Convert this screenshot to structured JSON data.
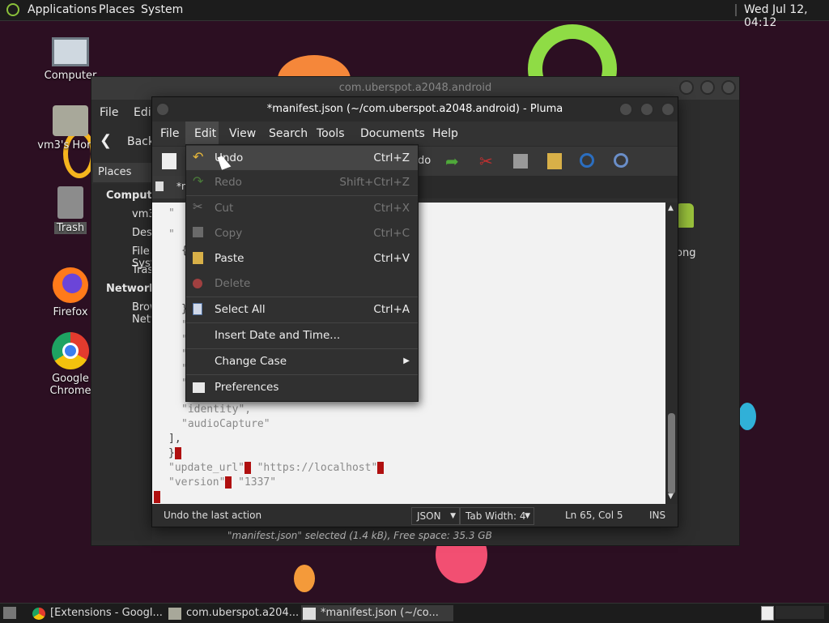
{
  "top_panel": {
    "menus": [
      "Applications",
      "Places",
      "System"
    ],
    "clock": "Wed Jul 12, 04:12"
  },
  "desktop_icons": [
    {
      "label": "Computer",
      "icon": "computer-icon"
    },
    {
      "label": "vm3's Home",
      "icon": "home-folder-icon"
    },
    {
      "label": "Trash",
      "icon": "trash-icon"
    },
    {
      "label": "Firefox",
      "icon": "firefox-icon"
    },
    {
      "label": "Google Chrome",
      "icon": "chrome-icon"
    }
  ],
  "file_manager": {
    "title": "com.uberspot.a2048.android",
    "menus": [
      "File",
      "Edit"
    ],
    "back_label": "Back",
    "places_label": "Places",
    "sidebar": {
      "computer_header": "Computer",
      "computer_items": [
        "vm3",
        "Desktop",
        "File System",
        "Trash"
      ],
      "network_header": "Network",
      "network_items": [
        "Browse Network"
      ]
    },
    "right_icon_label": "ong",
    "status": "\"manifest.json\" selected (1.4 kB), Free space: 35.3 GB"
  },
  "pluma": {
    "title": "*manifest.json (~/com.uberspot.a2048.android) - Pluma",
    "menus": [
      "File",
      "Edit",
      "View",
      "Search",
      "Tools",
      "Documents",
      "Help"
    ],
    "toolbar_partial_label": "do",
    "tab_label": "*n",
    "code_lines": [
      {
        "text": "\"identity\",",
        "indent": 2
      },
      {
        "text": "\"audioCapture\"",
        "indent": 2
      },
      {
        "text": "],",
        "indent": 1
      },
      {
        "text": "}",
        "indent": 1
      },
      {
        "text": "\"update_url\": \"https://localhost\",",
        "indent": 0
      },
      {
        "text": "\"version\": \"1337\"",
        "indent": 0
      }
    ],
    "status_message": "Undo the last action",
    "language": "JSON",
    "tab_width": "Tab Width:  4",
    "position": "Ln 65, Col 5",
    "mode": "INS"
  },
  "edit_menu": {
    "items": [
      {
        "label": "Undo",
        "accel": "Ctrl+Z",
        "icon": "undo-icon",
        "enabled": true,
        "hover": true
      },
      {
        "label": "Redo",
        "accel": "Shift+Ctrl+Z",
        "icon": "redo-icon",
        "enabled": false
      },
      {
        "label": "Cut",
        "accel": "Ctrl+X",
        "icon": "cut-icon",
        "enabled": false
      },
      {
        "label": "Copy",
        "accel": "Ctrl+C",
        "icon": "copy-icon",
        "enabled": false
      },
      {
        "label": "Paste",
        "accel": "Ctrl+V",
        "icon": "paste-icon",
        "enabled": true
      },
      {
        "label": "Delete",
        "accel": "",
        "icon": "delete-icon",
        "enabled": false
      },
      {
        "label": "Select All",
        "accel": "Ctrl+A",
        "icon": "select-all-icon",
        "enabled": true
      },
      {
        "label": "Insert Date and Time...",
        "accel": "",
        "icon": "",
        "enabled": true
      },
      {
        "label": "Change Case",
        "accel": "",
        "icon": "",
        "enabled": true,
        "submenu": true
      },
      {
        "label": "Preferences",
        "accel": "",
        "icon": "preferences-icon",
        "enabled": true
      }
    ]
  },
  "taskbar": {
    "tasks": [
      {
        "label": "[Extensions - Googl...",
        "icon": "chrome-icon"
      },
      {
        "label": "com.uberspot.a204...",
        "icon": "folder-icon"
      },
      {
        "label": "*manifest.json (~/co...",
        "icon": "text-editor-icon",
        "active": true
      }
    ]
  },
  "colors": {
    "wallpaper": "#2c0f22",
    "panel": "#1c1c1c",
    "error_highlight": "#b01010",
    "menu_bg": "#303030"
  }
}
